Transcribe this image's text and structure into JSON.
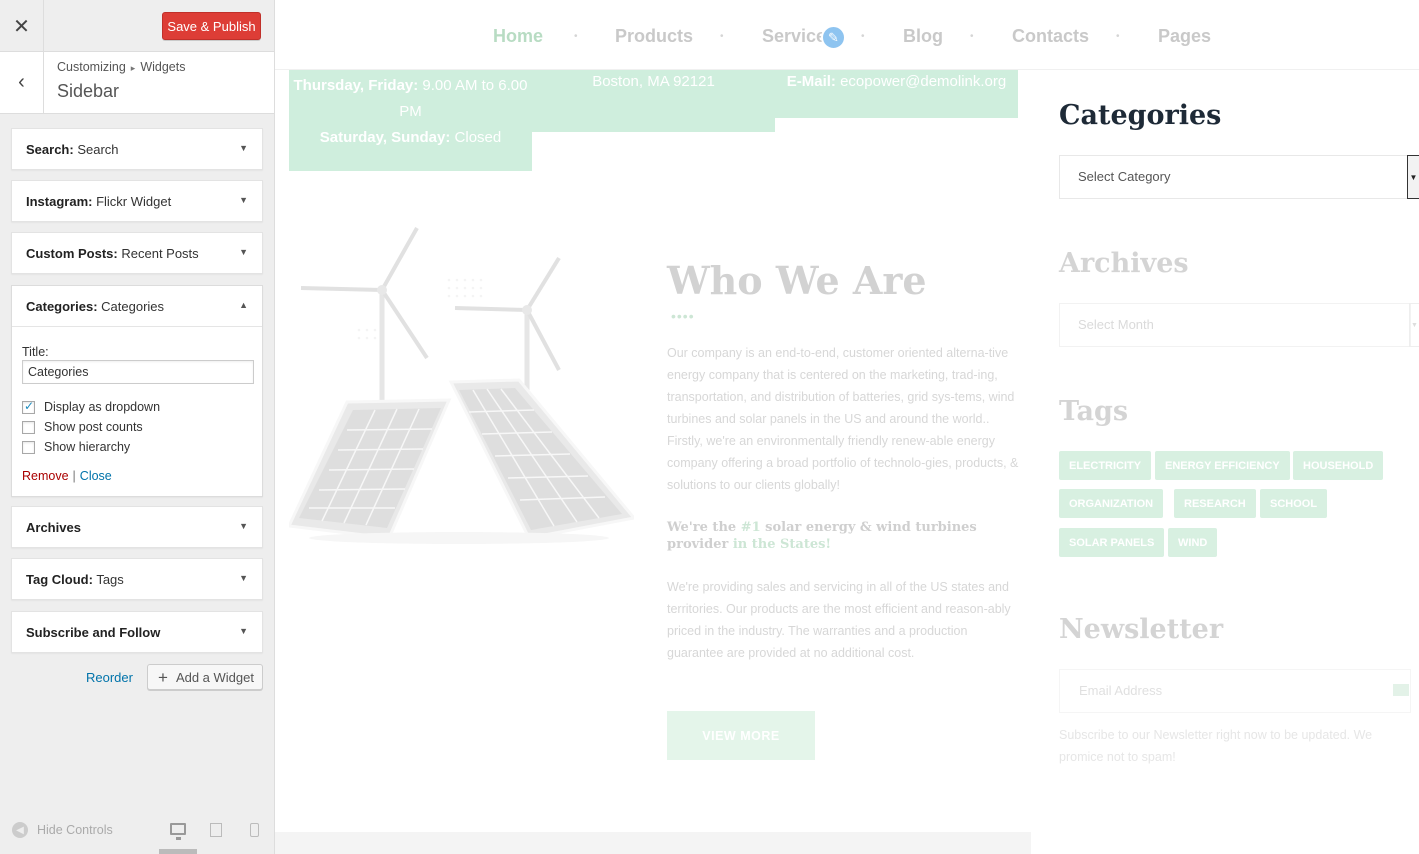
{
  "customizer": {
    "close_glyph": "✕",
    "save_publish_label": "Save & Publish",
    "back_glyph": "‹",
    "breadcrumb": {
      "parent": "Customizing",
      "separator": "▸",
      "current": "Widgets"
    },
    "section_title": "Sidebar",
    "widgets": [
      {
        "name": "Search:",
        "title": "Search"
      },
      {
        "name": "Instagram:",
        "title": "Flickr Widget"
      },
      {
        "name": "Custom Posts:",
        "title": "Recent Posts"
      },
      {
        "name": "Categories:",
        "title": "Categories",
        "expanded": true
      },
      {
        "name": "Archives",
        "title": ""
      },
      {
        "name": "Tag Cloud:",
        "title": "Tags"
      },
      {
        "name": "Subscribe and Follow",
        "title": ""
      }
    ],
    "categories_form": {
      "title_label": "Title:",
      "title_value": "Categories",
      "options": [
        {
          "label": "Display as dropdown",
          "checked": true
        },
        {
          "label": "Show post counts",
          "checked": false
        },
        {
          "label": "Show hierarchy",
          "checked": false
        }
      ],
      "remove_label": "Remove",
      "divider": "|",
      "close_label": "Close"
    },
    "reorder_label": "Reorder",
    "add_widget_label": "Add a Widget",
    "hide_controls_label": "Hide Controls",
    "accent_color": "#dd3d36",
    "link_color": "#0073aa"
  },
  "preview": {
    "nav": {
      "items": [
        "Home",
        "Products",
        "Service",
        "Blog",
        "Contacts",
        "Pages"
      ],
      "active": "Home",
      "dot": "•"
    },
    "info": {
      "hours_line1_bold": "Thursday, Friday:",
      "hours_line1": " 9.00 AM to 6.00 PM",
      "hours_line2_bold": "Saturday, Sunday:",
      "hours_line2": " Closed",
      "address": "Boston, MA 92121",
      "email_bold": "E-Mail:",
      "email": " ecopower@demolink.org"
    },
    "about": {
      "title": "Who We Are",
      "dots": "••••",
      "paragraph1": "Our company is an end-to-end, customer oriented alterna-tive energy company that is centered on the marketing, trad-ing, transportation, and distribution of batteries, grid sys-tems, wind turbines and solar panels in the US and around the world.. Firstly, we're an environmentally friendly renew-able energy company offering a broad portfolio of technolo-gies, products, & solutions to our clients globally!",
      "provider_a": "We're the ",
      "provider_hl": "#1",
      "provider_b": " solar energy & wind turbines provider ",
      "provider_hl2": "in the States!",
      "paragraph2": "We're providing sales and servicing in all of the US states and territories. Our products are the most efficient and reason-ably priced in the industry. The warranties and a production guarantee are provided at no additional cost.",
      "button": "VIEW MORE"
    },
    "sidebar": {
      "categories_title": "Categories",
      "categories_select": "Select Category",
      "archives_title": "Archives",
      "archives_select": "Select Month",
      "tags_title": "Tags",
      "tags": [
        "ELECTRICITY",
        "ENERGY EFFICIENCY",
        "HOUSEHOLD",
        "ORGANIZATION",
        "RESEARCH",
        "SCHOOL",
        "SOLAR PANELS",
        "WIND"
      ],
      "newsletter_title": "Newsletter",
      "email_placeholder": "Email Address",
      "newsletter_text": "Subscribe to our Newsletter right now to be updated. We promice not to spam!"
    },
    "brand_color": "#b8dcc3"
  }
}
